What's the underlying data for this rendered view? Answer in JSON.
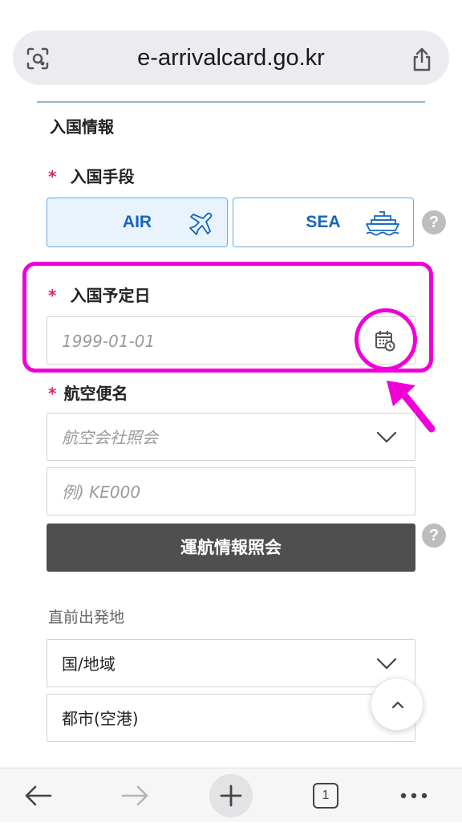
{
  "browser": {
    "url": "e-arrivalcard.go.kr",
    "tab_count": "1"
  },
  "form": {
    "section_title": "入国情報",
    "entry_mode": {
      "required_mark": "*",
      "label": "入国手段",
      "options": [
        {
          "label": "AIR",
          "selected": true,
          "icon": "airplane-icon"
        },
        {
          "label": "SEA",
          "selected": false,
          "icon": "ship-icon"
        }
      ],
      "help": "?"
    },
    "entry_date": {
      "required_mark": "*",
      "label": "入国予定日",
      "placeholder": "1999-01-01",
      "icon": "calendar-icon"
    },
    "flight": {
      "required_mark": "*",
      "label": "航空便名",
      "airline_placeholder": "航空会社照会",
      "number_placeholder": "例) KE000",
      "lookup_button": "運航情報照会",
      "help": "?"
    },
    "departure": {
      "label": "直前出発地",
      "country_value": "国/地域",
      "city_value": "都市(空港)"
    }
  },
  "colors": {
    "highlight": "#f000d8",
    "accent": "#1565c0",
    "required": "#e0245e",
    "button_dark": "#4f4f4f"
  }
}
